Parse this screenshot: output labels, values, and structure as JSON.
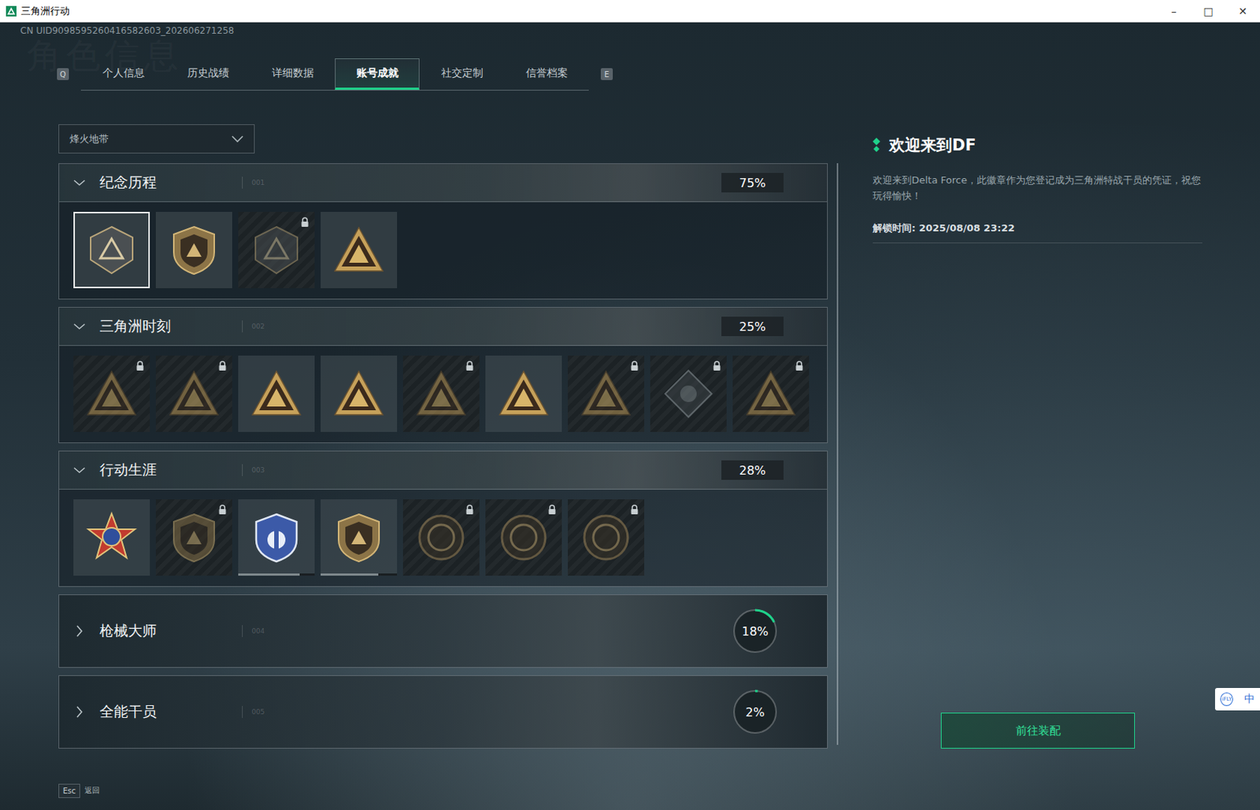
{
  "window": {
    "title": "三角洲行动",
    "controls": [
      "–",
      "□",
      "✕"
    ]
  },
  "uid": "CN UID9098595260416582603_202606271258",
  "watermark": "角色信息",
  "tabs": {
    "prev_key": "Q",
    "next_key": "E",
    "items": [
      {
        "label": "个人信息",
        "selected": false
      },
      {
        "label": "历史战绩",
        "selected": false
      },
      {
        "label": "详细数据",
        "selected": false
      },
      {
        "label": "账号成就",
        "selected": true
      },
      {
        "label": "社交定制",
        "selected": false
      },
      {
        "label": "信誉档案",
        "selected": false
      }
    ]
  },
  "mode_select": {
    "value": "烽火地带"
  },
  "sections": [
    {
      "title": "纪念历程",
      "index": "001",
      "expanded": true,
      "percent": "75%",
      "badges": [
        {
          "kind": "hex",
          "locked": false,
          "selected": true
        },
        {
          "kind": "shield",
          "locked": false,
          "selected": false
        },
        {
          "kind": "hex",
          "locked": true,
          "selected": false
        },
        {
          "kind": "triangle",
          "locked": false,
          "selected": false
        }
      ]
    },
    {
      "title": "三角洲时刻",
      "index": "002",
      "expanded": true,
      "percent": "25%",
      "badges": [
        {
          "kind": "triangle",
          "locked": true,
          "selected": false
        },
        {
          "kind": "triangle",
          "locked": true,
          "selected": false
        },
        {
          "kind": "triangle",
          "locked": false,
          "selected": false
        },
        {
          "kind": "triangle",
          "locked": false,
          "selected": false
        },
        {
          "kind": "triangle",
          "locked": true,
          "selected": false
        },
        {
          "kind": "triangle",
          "locked": false,
          "selected": false
        },
        {
          "kind": "triangle",
          "locked": true,
          "selected": false
        },
        {
          "kind": "diamond",
          "locked": true,
          "selected": false
        },
        {
          "kind": "triangle",
          "locked": true,
          "selected": false
        }
      ]
    },
    {
      "title": "行动生涯",
      "index": "003",
      "expanded": true,
      "percent": "28%",
      "badges": [
        {
          "kind": "medal",
          "locked": false,
          "selected": false
        },
        {
          "kind": "shield",
          "locked": true,
          "selected": false
        },
        {
          "kind": "blue-shield",
          "locked": false,
          "selected": false,
          "level": 0.8
        },
        {
          "kind": "shield",
          "locked": false,
          "selected": false,
          "level": 0.75
        },
        {
          "kind": "round",
          "locked": true,
          "selected": false
        },
        {
          "kind": "round",
          "locked": true,
          "selected": false
        },
        {
          "kind": "round",
          "locked": true,
          "selected": false
        }
      ]
    },
    {
      "title": "枪械大师",
      "index": "004",
      "expanded": false,
      "percent": "18%",
      "level": 0.18,
      "badges": []
    },
    {
      "title": "全能干员",
      "index": "005",
      "expanded": false,
      "percent": "2%",
      "level": 0.02,
      "badges": []
    }
  ],
  "detail": {
    "title": "欢迎来到DF",
    "description": "欢迎来到Delta Force，此徽章作为您登记成为三角洲特战干员的凭证，祝您玩得愉快！",
    "unlock": "解锁时间: 2025/08/08 23:22",
    "button": "前往装配"
  },
  "footer": {
    "key": "Esc",
    "label": "返回"
  },
  "ime": {
    "brand": "iFLY",
    "mode": "中"
  }
}
